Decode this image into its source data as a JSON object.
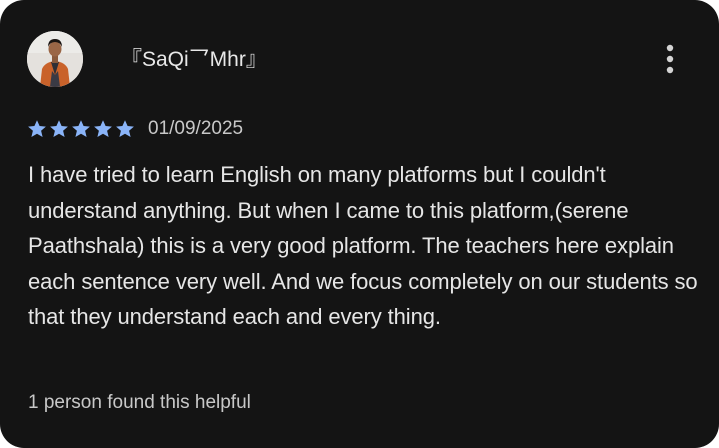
{
  "review": {
    "reviewer_name": "『SaQi乛Mhr』",
    "avatar_icon": "user-avatar-photo",
    "more_icon": "more-vert-icon",
    "rating": 5,
    "rating_max": 5,
    "star_color": "#8ab4f8",
    "date": "01/09/2025",
    "text": "I have tried to learn English on many platforms but I couldn't understand anything. But when I came to this platform,(serene Paathshala) this is a very good platform. The teachers here explain each sentence very well. And we focus completely on our students so that they understand each and every thing.",
    "helpful": "1 person found this helpful"
  },
  "colors": {
    "card_background": "#141414",
    "text_primary": "#e6e6e6",
    "text_secondary": "#c8c8c8"
  }
}
